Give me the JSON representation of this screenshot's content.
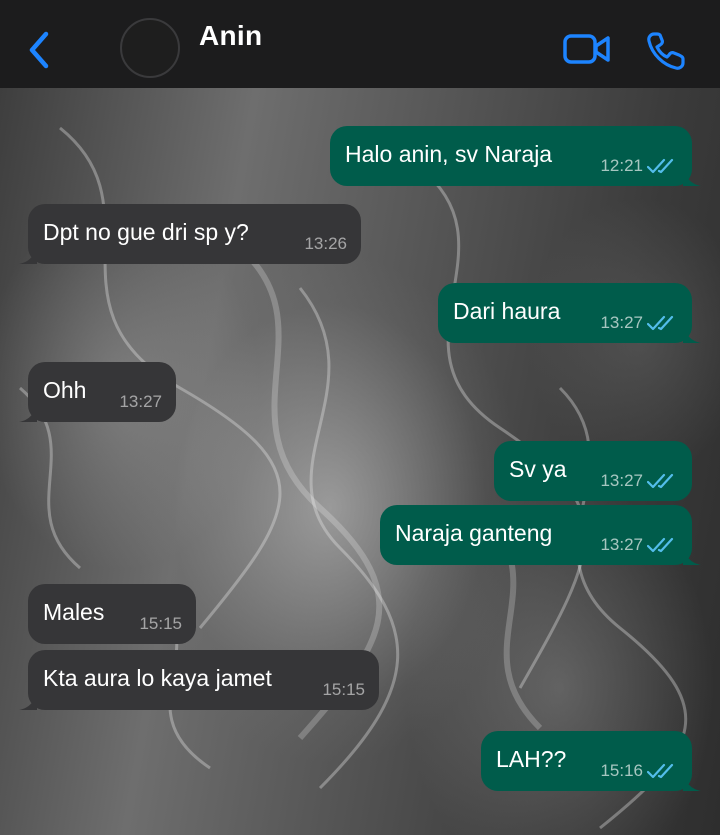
{
  "header": {
    "contact_name": "Anin",
    "icons": {
      "back": "chevron-left-icon",
      "avatar": "contact-avatar",
      "video": "video-camera-icon",
      "call": "phone-icon"
    },
    "accent_color": "#1d84ff"
  },
  "colors": {
    "outgoing_bubble": "#005c4b",
    "incoming_bubble": "#363638",
    "read_ticks": "#53bdeb"
  },
  "messages": [
    {
      "direction": "out",
      "text": "Halo anin, sv Naraja",
      "time": "12:21",
      "status": "read"
    },
    {
      "direction": "in",
      "text": "Dpt no gue dri sp y?",
      "time": "13:26"
    },
    {
      "direction": "out",
      "text": "Dari haura",
      "time": "13:27",
      "status": "read"
    },
    {
      "direction": "in",
      "text": "Ohh",
      "time": "13:27"
    },
    {
      "direction": "out",
      "text": "Sv ya",
      "time": "13:27",
      "status": "read"
    },
    {
      "direction": "out",
      "text": "Naraja ganteng",
      "time": "13:27",
      "status": "read"
    },
    {
      "direction": "in",
      "text": "Males",
      "time": "15:15"
    },
    {
      "direction": "in",
      "text": "Kta aura lo kaya jamet",
      "time": "15:15"
    },
    {
      "direction": "out",
      "text": "LAH??",
      "time": "15:16",
      "status": "read"
    }
  ]
}
